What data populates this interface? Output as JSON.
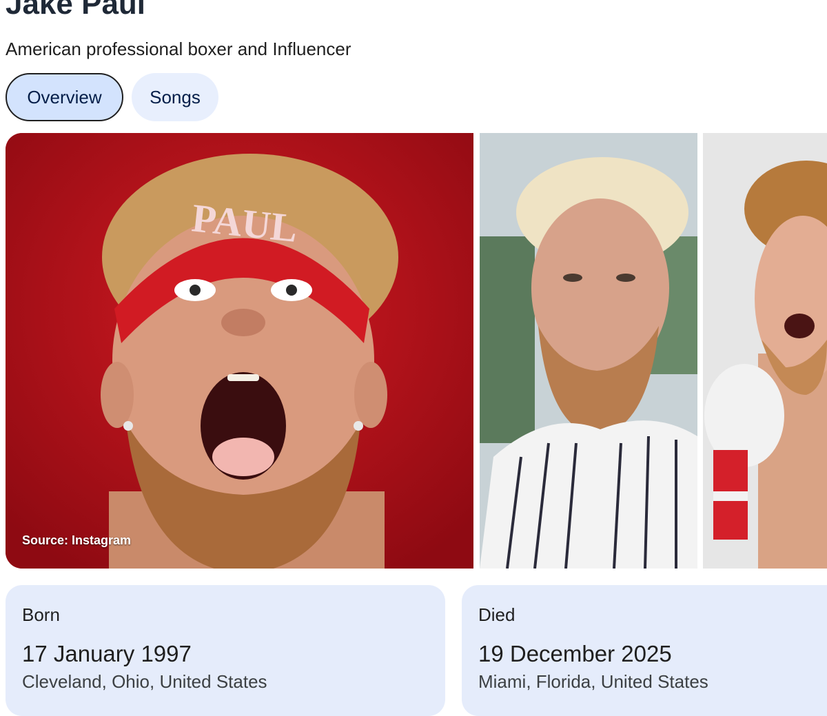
{
  "header": {
    "title": "Jake Paul",
    "subtitle": "American professional boxer and Influencer"
  },
  "tabs": [
    {
      "label": "Overview",
      "active": true
    },
    {
      "label": "Songs",
      "active": false
    }
  ],
  "gallery": {
    "main_caption": "Source: Instagram",
    "headband_text": "PAUL",
    "images": [
      "portrait-red-background",
      "portrait-pinstripe-jersey",
      "portrait-boxing-glove"
    ]
  },
  "facts": {
    "born": {
      "label": "Born",
      "date": "17 January 1997",
      "place": "Cleveland, Ohio, United States"
    },
    "died": {
      "label": "Died",
      "date": "19 December 2025",
      "place": "Miami, Florida, United States"
    }
  },
  "colors": {
    "tab_active_bg": "#d3e3fd",
    "tab_inactive_bg": "#e8effd",
    "card_bg": "#e5ecfb",
    "photo_bg_red": "#b8101a"
  }
}
